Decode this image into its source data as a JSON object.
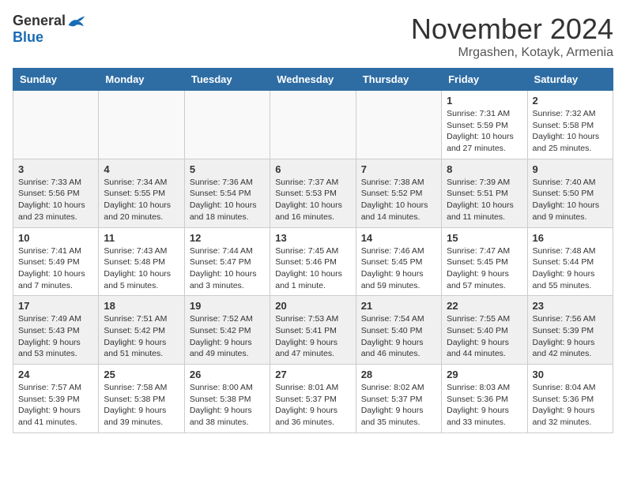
{
  "header": {
    "logo_general": "General",
    "logo_blue": "Blue",
    "month_title": "November 2024",
    "location": "Mrgashen, Kotayk, Armenia"
  },
  "weekdays": [
    "Sunday",
    "Monday",
    "Tuesday",
    "Wednesday",
    "Thursday",
    "Friday",
    "Saturday"
  ],
  "rows": [
    [
      {
        "day": "",
        "info": ""
      },
      {
        "day": "",
        "info": ""
      },
      {
        "day": "",
        "info": ""
      },
      {
        "day": "",
        "info": ""
      },
      {
        "day": "",
        "info": ""
      },
      {
        "day": "1",
        "info": "Sunrise: 7:31 AM\nSunset: 5:59 PM\nDaylight: 10 hours\nand 27 minutes."
      },
      {
        "day": "2",
        "info": "Sunrise: 7:32 AM\nSunset: 5:58 PM\nDaylight: 10 hours\nand 25 minutes."
      }
    ],
    [
      {
        "day": "3",
        "info": "Sunrise: 7:33 AM\nSunset: 5:56 PM\nDaylight: 10 hours\nand 23 minutes."
      },
      {
        "day": "4",
        "info": "Sunrise: 7:34 AM\nSunset: 5:55 PM\nDaylight: 10 hours\nand 20 minutes."
      },
      {
        "day": "5",
        "info": "Sunrise: 7:36 AM\nSunset: 5:54 PM\nDaylight: 10 hours\nand 18 minutes."
      },
      {
        "day": "6",
        "info": "Sunrise: 7:37 AM\nSunset: 5:53 PM\nDaylight: 10 hours\nand 16 minutes."
      },
      {
        "day": "7",
        "info": "Sunrise: 7:38 AM\nSunset: 5:52 PM\nDaylight: 10 hours\nand 14 minutes."
      },
      {
        "day": "8",
        "info": "Sunrise: 7:39 AM\nSunset: 5:51 PM\nDaylight: 10 hours\nand 11 minutes."
      },
      {
        "day": "9",
        "info": "Sunrise: 7:40 AM\nSunset: 5:50 PM\nDaylight: 10 hours\nand 9 minutes."
      }
    ],
    [
      {
        "day": "10",
        "info": "Sunrise: 7:41 AM\nSunset: 5:49 PM\nDaylight: 10 hours\nand 7 minutes."
      },
      {
        "day": "11",
        "info": "Sunrise: 7:43 AM\nSunset: 5:48 PM\nDaylight: 10 hours\nand 5 minutes."
      },
      {
        "day": "12",
        "info": "Sunrise: 7:44 AM\nSunset: 5:47 PM\nDaylight: 10 hours\nand 3 minutes."
      },
      {
        "day": "13",
        "info": "Sunrise: 7:45 AM\nSunset: 5:46 PM\nDaylight: 10 hours\nand 1 minute."
      },
      {
        "day": "14",
        "info": "Sunrise: 7:46 AM\nSunset: 5:45 PM\nDaylight: 9 hours\nand 59 minutes."
      },
      {
        "day": "15",
        "info": "Sunrise: 7:47 AM\nSunset: 5:45 PM\nDaylight: 9 hours\nand 57 minutes."
      },
      {
        "day": "16",
        "info": "Sunrise: 7:48 AM\nSunset: 5:44 PM\nDaylight: 9 hours\nand 55 minutes."
      }
    ],
    [
      {
        "day": "17",
        "info": "Sunrise: 7:49 AM\nSunset: 5:43 PM\nDaylight: 9 hours\nand 53 minutes."
      },
      {
        "day": "18",
        "info": "Sunrise: 7:51 AM\nSunset: 5:42 PM\nDaylight: 9 hours\nand 51 minutes."
      },
      {
        "day": "19",
        "info": "Sunrise: 7:52 AM\nSunset: 5:42 PM\nDaylight: 9 hours\nand 49 minutes."
      },
      {
        "day": "20",
        "info": "Sunrise: 7:53 AM\nSunset: 5:41 PM\nDaylight: 9 hours\nand 47 minutes."
      },
      {
        "day": "21",
        "info": "Sunrise: 7:54 AM\nSunset: 5:40 PM\nDaylight: 9 hours\nand 46 minutes."
      },
      {
        "day": "22",
        "info": "Sunrise: 7:55 AM\nSunset: 5:40 PM\nDaylight: 9 hours\nand 44 minutes."
      },
      {
        "day": "23",
        "info": "Sunrise: 7:56 AM\nSunset: 5:39 PM\nDaylight: 9 hours\nand 42 minutes."
      }
    ],
    [
      {
        "day": "24",
        "info": "Sunrise: 7:57 AM\nSunset: 5:39 PM\nDaylight: 9 hours\nand 41 minutes."
      },
      {
        "day": "25",
        "info": "Sunrise: 7:58 AM\nSunset: 5:38 PM\nDaylight: 9 hours\nand 39 minutes."
      },
      {
        "day": "26",
        "info": "Sunrise: 8:00 AM\nSunset: 5:38 PM\nDaylight: 9 hours\nand 38 minutes."
      },
      {
        "day": "27",
        "info": "Sunrise: 8:01 AM\nSunset: 5:37 PM\nDaylight: 9 hours\nand 36 minutes."
      },
      {
        "day": "28",
        "info": "Sunrise: 8:02 AM\nSunset: 5:37 PM\nDaylight: 9 hours\nand 35 minutes."
      },
      {
        "day": "29",
        "info": "Sunrise: 8:03 AM\nSunset: 5:36 PM\nDaylight: 9 hours\nand 33 minutes."
      },
      {
        "day": "30",
        "info": "Sunrise: 8:04 AM\nSunset: 5:36 PM\nDaylight: 9 hours\nand 32 minutes."
      }
    ]
  ]
}
